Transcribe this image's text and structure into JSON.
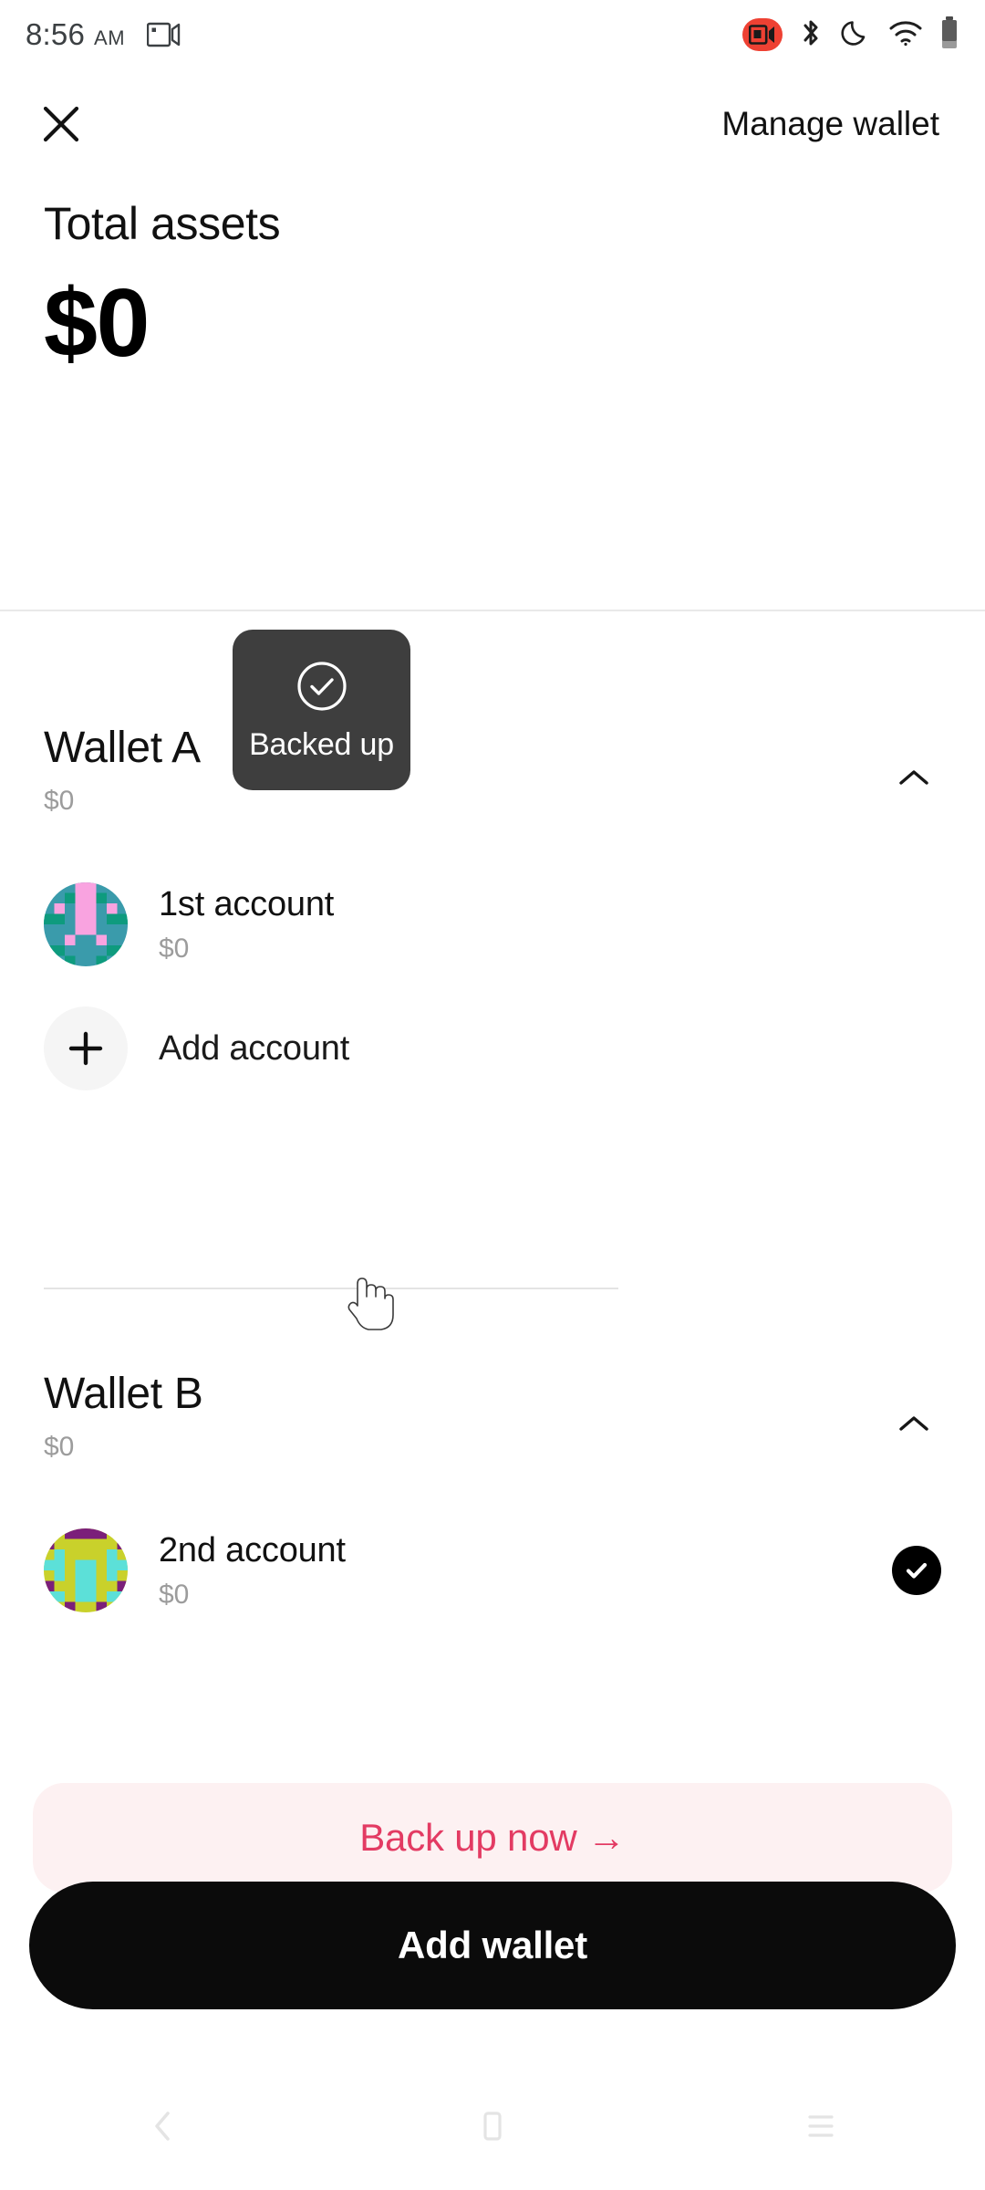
{
  "status_bar": {
    "time": "8:56",
    "meridiem": "AM",
    "icons": [
      "cast-icon",
      "screen-record-icon",
      "bluetooth-icon",
      "do-not-disturb-icon",
      "wifi-icon",
      "battery-icon"
    ],
    "record_badge_color": "#ee4133"
  },
  "header": {
    "close_icon": "close-icon",
    "manage_wallet_label": "Manage wallet"
  },
  "totals": {
    "label": "Total assets",
    "amount": "$0"
  },
  "wallets": [
    {
      "name": "Wallet A",
      "amount": "$0",
      "collapse_icon": "chevron-up-icon",
      "accounts": [
        {
          "name": "1st account",
          "amount": "$0",
          "selected": false,
          "avatar": "identicon-teal-pink"
        }
      ],
      "add_account_label": "Add account",
      "add_account_icon": "plus-icon"
    },
    {
      "name": "Wallet B",
      "amount": "$0",
      "collapse_icon": "chevron-up-icon",
      "accounts": [
        {
          "name": "2nd account",
          "amount": "$0",
          "selected": true,
          "avatar": "identicon-yellow-cyan-purple",
          "selected_icon": "check-circle-filled-icon"
        }
      ]
    }
  ],
  "backup_banner": {
    "label": "Back up now  →",
    "text_color": "#e33b63",
    "background_color": "#fdf1f2"
  },
  "primary_button": {
    "label": "Add wallet",
    "background_color": "#0b0b0b"
  },
  "toast": {
    "icon": "check-circle-outline-icon",
    "label": "Backed up",
    "background_color": "#3e3e3e"
  },
  "nav_bar": {
    "back_icon": "nav-back-icon",
    "home_icon": "nav-home-icon",
    "recents_icon": "nav-recents-icon"
  }
}
